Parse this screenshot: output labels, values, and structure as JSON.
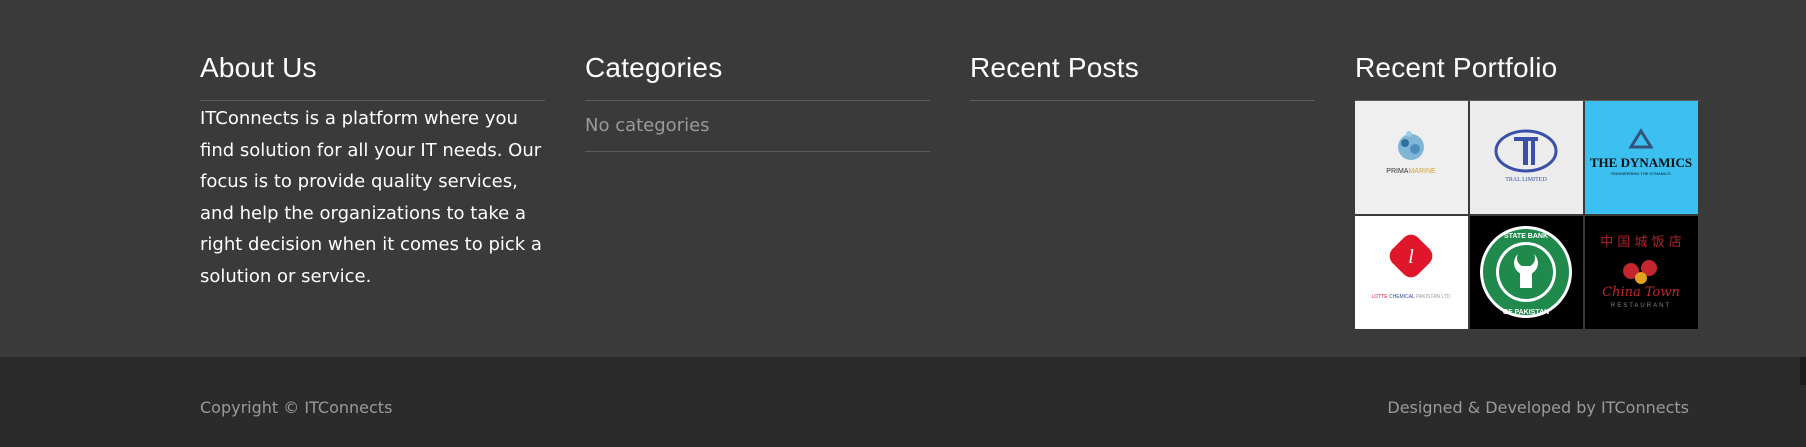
{
  "about": {
    "title": "About Us",
    "text": "ITConnects is a platform where you find solution for all your IT needs. Our focus is to provide quality services, and help the organizations to take a right decision when it comes to pick a solution or service."
  },
  "categories": {
    "title": "Categories",
    "empty_text": "No categories"
  },
  "recent_posts": {
    "title": "Recent Posts"
  },
  "portfolio": {
    "title": "Recent Portfolio",
    "items": [
      {
        "logo_text": "PRIMA MARINE",
        "bg": "#efefef"
      },
      {
        "logo_text": "TRAL LIMITED",
        "bg": "#ececec"
      },
      {
        "logo_text": "THE DYNAMICS",
        "bg": "#3cc0f2"
      },
      {
        "logo_text": "LOTTE CHEMICAL",
        "bg": "#ffffff"
      },
      {
        "logo_text": "STATE BANK OF PAKISTAN",
        "bg": "#000000"
      },
      {
        "logo_text": "China Town",
        "bg": "#000000"
      }
    ]
  },
  "footer": {
    "copyright": "Copyright © ITConnects",
    "credits_prefix": "Designed & Developed by ",
    "credits_link": "ITConnects"
  }
}
